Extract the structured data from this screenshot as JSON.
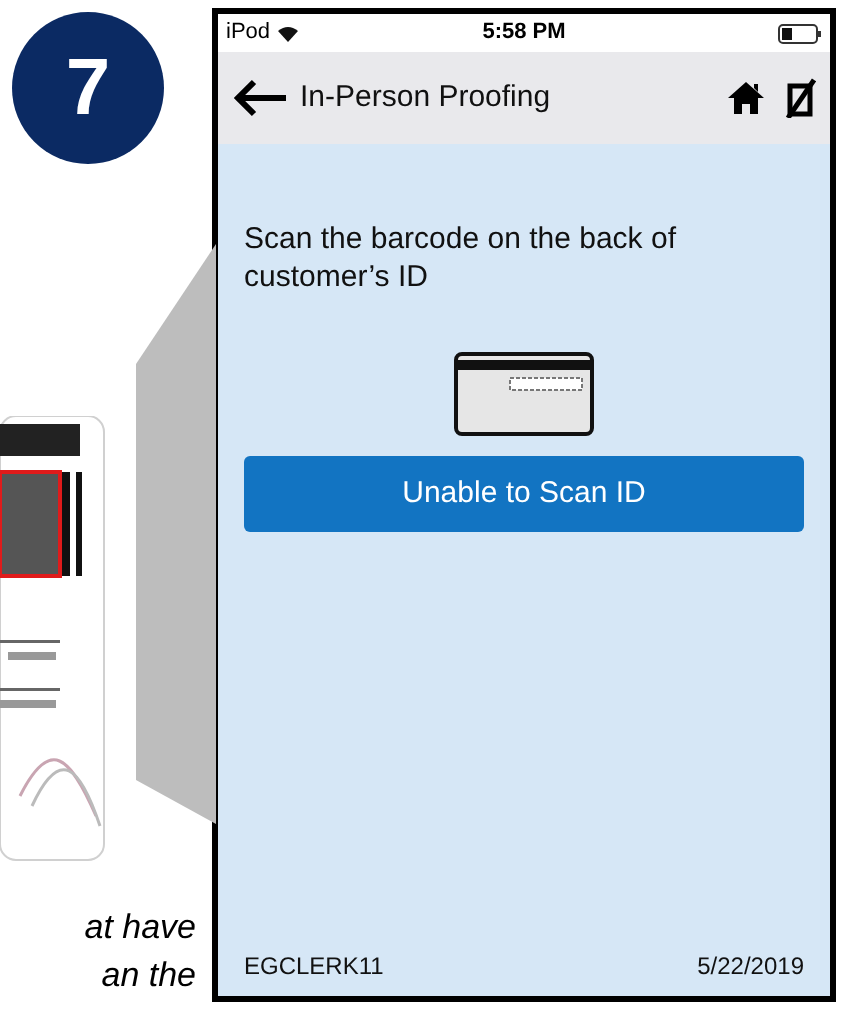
{
  "step": {
    "number": "7"
  },
  "caption_lines": [
    "at have",
    "an the"
  ],
  "device": {
    "status_bar": {
      "carrier": "iPod",
      "time": "5:58 PM"
    },
    "nav_bar": {
      "title": "In-Person Proofing"
    },
    "instruction": "Scan the barcode on the back of customer’s ID",
    "button": "Unable to Scan ID",
    "footer": {
      "user": "EGCLERK11",
      "date": "5/22/2019"
    }
  }
}
